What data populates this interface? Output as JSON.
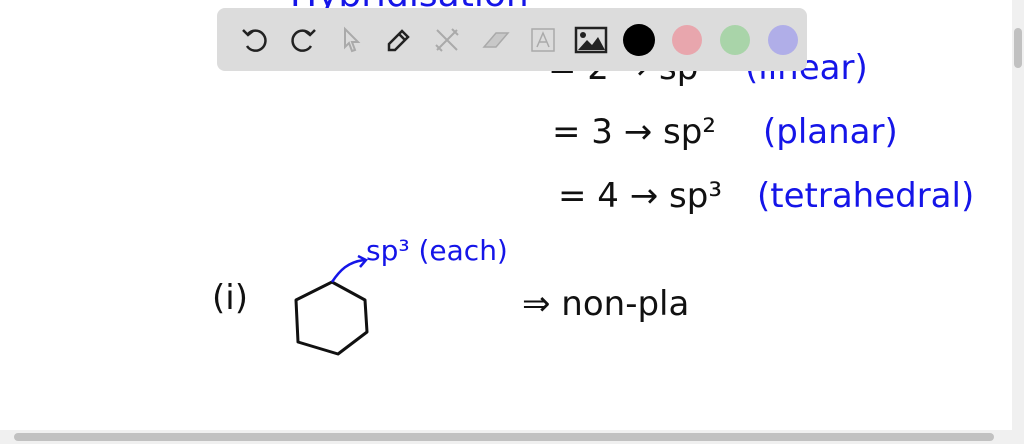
{
  "board": {
    "title_partial": "Hybridisation",
    "line1": {
      "eq": "= 2 → sp",
      "note": "(linear)"
    },
    "line2": {
      "eq": "= 3 → sp²",
      "note": "(planar)"
    },
    "line3": {
      "eq": "= 4 → sp³",
      "note": "(tetrahedral)"
    },
    "label_i": "(i)",
    "annotation": "sp³ (each)",
    "conclusion": "⇒ non-pla"
  },
  "toolbar": {
    "tools": [
      "undo-icon",
      "redo-icon",
      "pointer-icon",
      "pen-icon",
      "tools-icon",
      "eraser-icon",
      "text-icon",
      "image-icon"
    ],
    "colors": [
      "#000000",
      "#e8a6ad",
      "#a9d4a9",
      "#b0aee8"
    ]
  }
}
